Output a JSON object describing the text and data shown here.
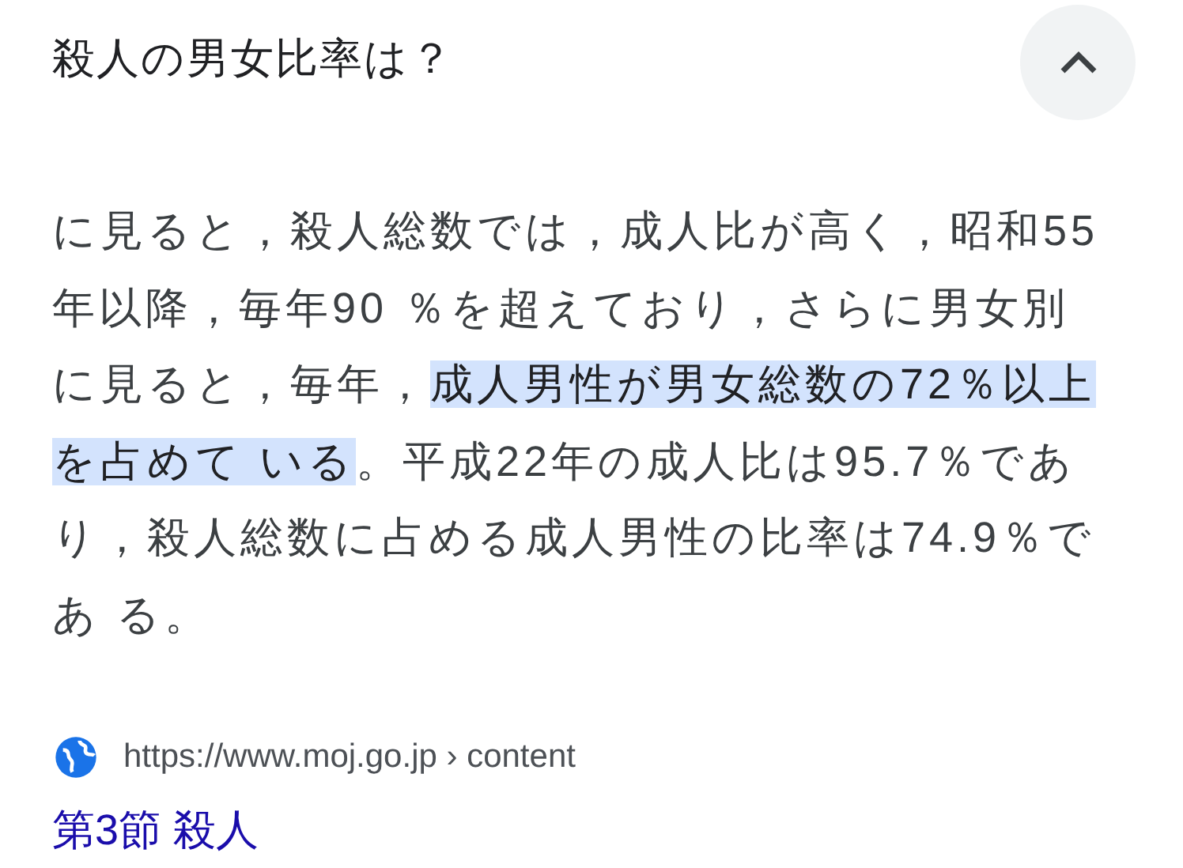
{
  "question": "殺人の男女比率は？",
  "collapse_button": {
    "expanded": true
  },
  "snippet": [
    {
      "text": "に見ると，殺人総数では，成人比が高く，昭和55年以降，毎年90 ％を超えており，さらに男女別に見ると，毎年，",
      "highlighted": false
    },
    {
      "text": "成人男性が男女総数の72％以上を占めて いる",
      "highlighted": true
    },
    {
      "text": "。平成22年の成人比は95.7％であり，殺人総数に占める成人男性の比率は74.9％であ る。",
      "highlighted": false
    }
  ],
  "source": {
    "url": "https://www.moj.go.jp › content",
    "title": "第3節 殺人"
  }
}
